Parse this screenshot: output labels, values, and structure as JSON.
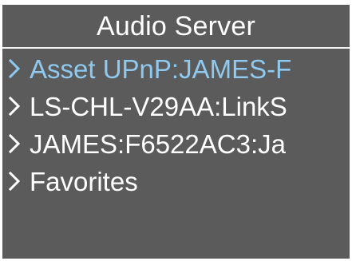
{
  "screen": {
    "title": "Audio Server"
  },
  "menu": {
    "items": [
      {
        "label": "Asset UPnP:JAMES-F",
        "selected": true,
        "icon": "chevron-right-icon"
      },
      {
        "label": "LS-CHL-V29AA:LinkS",
        "selected": false,
        "icon": "chevron-right-icon"
      },
      {
        "label": "JAMES:F6522AC3:Ja",
        "selected": false,
        "icon": "chevron-right-icon"
      },
      {
        "label": "Favorites",
        "selected": false,
        "icon": "chevron-right-icon"
      }
    ]
  },
  "colors": {
    "background": "#5b5b5b",
    "text": "#ffffff",
    "selected_text": "#8fc9ef",
    "divider": "#f2f2f2"
  }
}
